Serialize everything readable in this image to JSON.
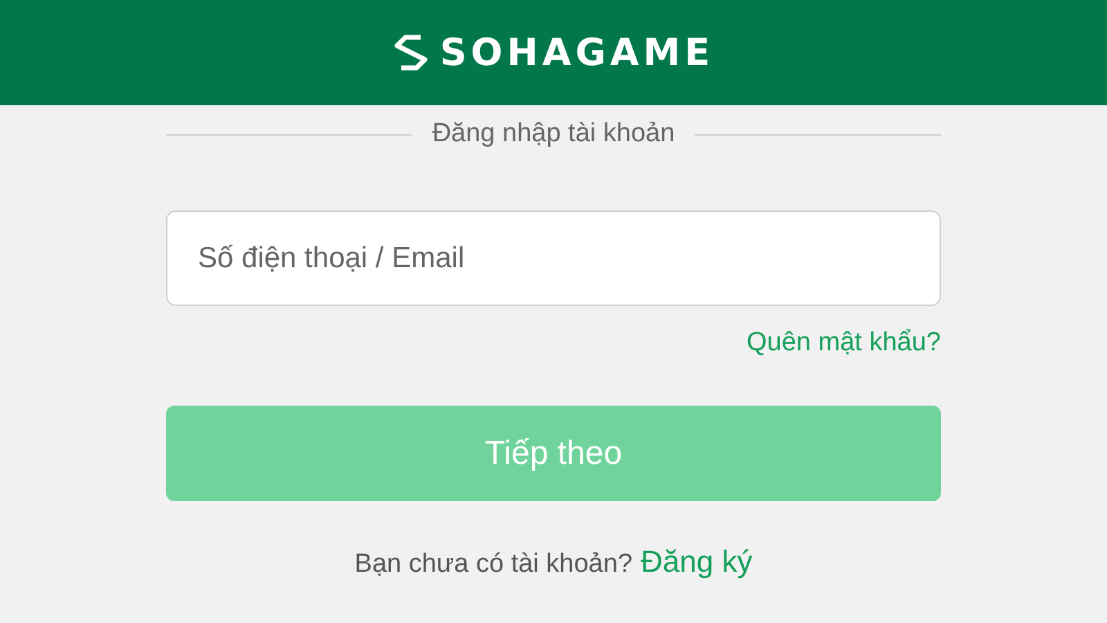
{
  "header": {
    "logo_text": "SOHAGAME"
  },
  "title": "Đăng nhập tài khoản",
  "login_field": {
    "placeholder": "Số điện thoại / Email"
  },
  "forgot_link": "Quên mật khẩu?",
  "next_button": {
    "label": "Tiếp theo",
    "disabled": true
  },
  "signup": {
    "prompt": "Bạn chưa có tài khoản?",
    "link": "Đăng ký"
  }
}
